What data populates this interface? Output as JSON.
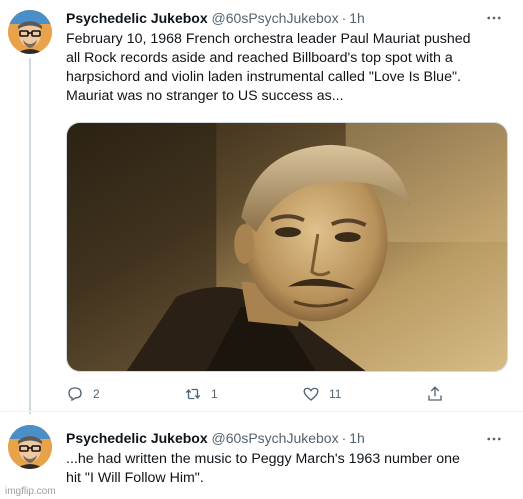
{
  "tweets": [
    {
      "author_name": "Psychedelic Jukebox",
      "handle": "@60sPsychJukebox",
      "separator": "·",
      "time": "1h",
      "text": "February 10, 1968 French orchestra leader Paul Mauriat pushed\nall Rock records aside and reached Billboard's top spot with a\nharpsichord and violin laden instrumental called \"Love Is Blue\".\nMauriat was no stranger to US success as...",
      "actions": {
        "reply_count": "2",
        "retweet_count": "1",
        "like_count": "11"
      }
    },
    {
      "author_name": "Psychedelic Jukebox",
      "handle": "@60sPsychJukebox",
      "separator": "·",
      "time": "1h",
      "text": "...he had written the music to Peggy March's 1963 number one\nhit \"I Will Follow Him\"."
    }
  ],
  "watermark": "imgflip.com",
  "icons": {
    "more": "more-horizontal-icon",
    "reply": "reply-icon",
    "retweet": "retweet-icon",
    "like": "heart-icon",
    "share": "share-icon"
  },
  "colors": {
    "text": "#0f1419",
    "secondary": "#536471",
    "thread_line": "#cfd9de",
    "photo_tone": "#c9a86a"
  }
}
